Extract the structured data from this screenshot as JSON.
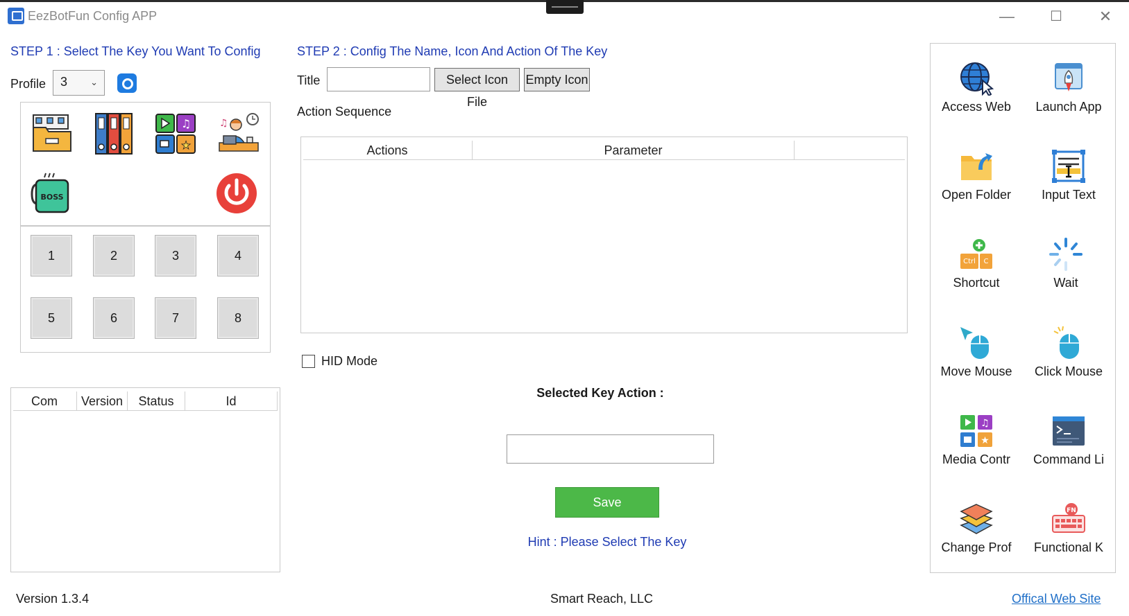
{
  "window": {
    "title": "EezBotFun Config APP",
    "controls": {
      "minimize": "—",
      "maximize": "☐",
      "close": "✕"
    }
  },
  "step1": {
    "heading": "STEP 1 : Select The Key You Want To Config",
    "profile_label": "Profile",
    "profile_value": "3",
    "icons": [
      "folder-documents-icon",
      "binders-icon",
      "media-apps-icon",
      "music-desk-person-icon",
      "boss-mug-icon",
      "power-icon"
    ],
    "keys": [
      "1",
      "2",
      "3",
      "4",
      "5",
      "6",
      "7",
      "8"
    ]
  },
  "devices_table": {
    "columns": [
      "Com",
      "Version",
      "Status",
      "Id"
    ],
    "rows": []
  },
  "step2": {
    "heading": "STEP 2 : Config The Name, Icon And Action Of The Key",
    "title_label": "Title",
    "title_value": "",
    "select_icon_button": "Select Icon File",
    "empty_icon_button": "Empty Icon",
    "action_sequence_label": "Action Sequence",
    "columns": [
      "Actions",
      "Parameter"
    ],
    "rows": [],
    "hid_mode_label": "HID Mode",
    "hid_mode_checked": false,
    "selected_key_action_label": "Selected Key Action :",
    "selected_key_action_value": "",
    "save_button": "Save",
    "hint": "Hint : Please Select The Key"
  },
  "actions_palette": [
    {
      "label": "Access Web",
      "icon": "globe-cursor-icon"
    },
    {
      "label": "Launch App",
      "icon": "rocket-window-icon"
    },
    {
      "label": "Open Folder",
      "icon": "folder-arrow-icon"
    },
    {
      "label": "Input Text",
      "icon": "text-cursor-icon"
    },
    {
      "label": "Shortcut",
      "icon": "ctrl-c-keys-icon"
    },
    {
      "label": "Wait",
      "icon": "spinner-icon"
    },
    {
      "label": "Move Mouse",
      "icon": "mouse-move-icon"
    },
    {
      "label": "Click Mouse",
      "icon": "mouse-click-icon"
    },
    {
      "label": "Media Contr",
      "icon": "media-controls-icon"
    },
    {
      "label": "Command Li",
      "icon": "terminal-icon"
    },
    {
      "label": "Change Prof",
      "icon": "layers-icon"
    },
    {
      "label": "Functional K",
      "icon": "fn-keyboard-icon"
    }
  ],
  "footer": {
    "version": "Version 1.3.4",
    "company": "Smart Reach, LLC",
    "website_link": "Offical Web Site"
  },
  "colors": {
    "heading_blue": "#1f3bb3",
    "save_green": "#4cb848",
    "power_red": "#e8403a",
    "link_blue": "#1f6fc8"
  }
}
